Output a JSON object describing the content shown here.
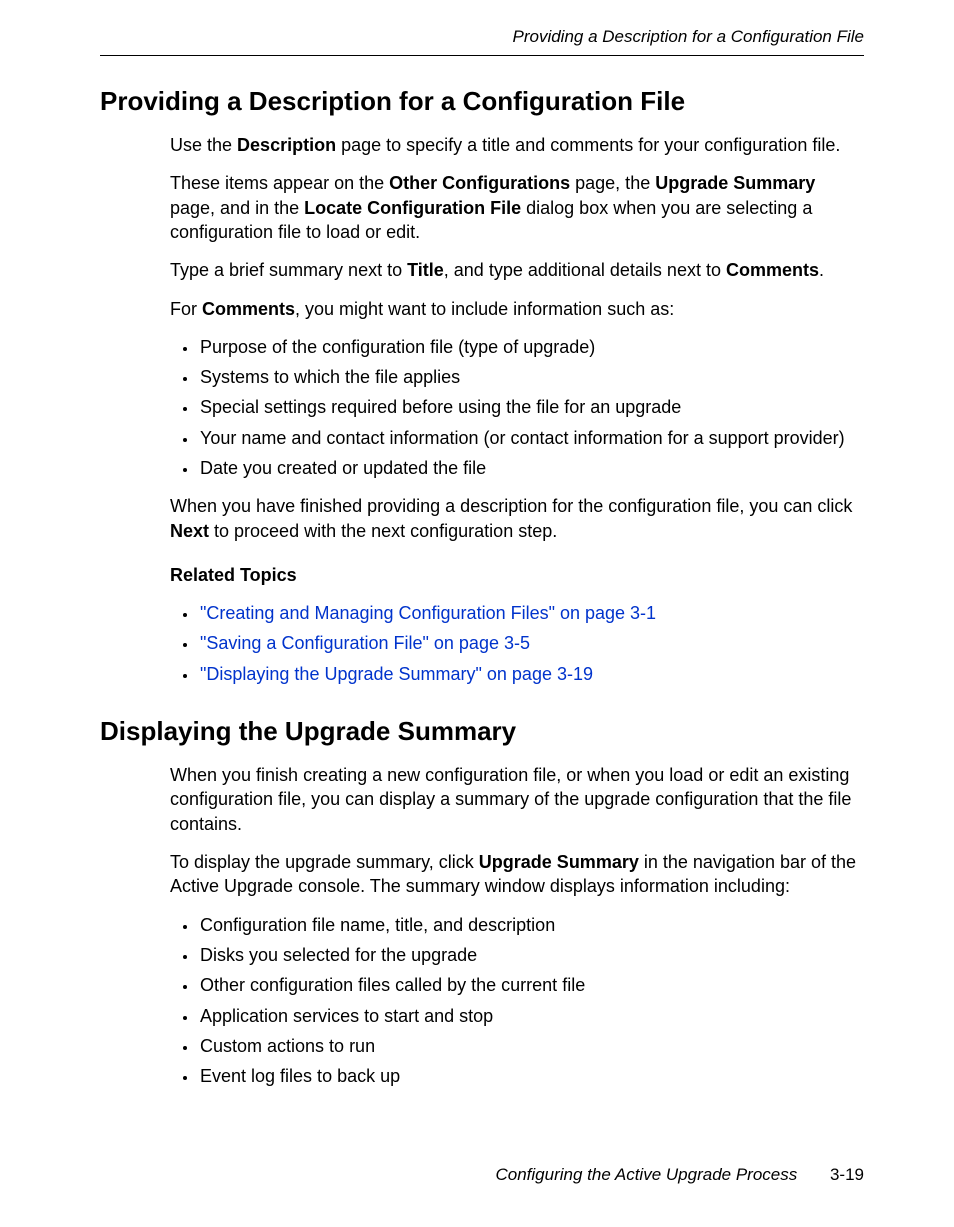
{
  "header": {
    "running_head": "Providing a Description for a Configuration File"
  },
  "section1": {
    "title": "Providing a Description for a Configuration File",
    "para1_pre": "Use the ",
    "para1_b1": "Description",
    "para1_post": " page to specify a title and comments for your configuration file.",
    "para2_a": "These items appear on the ",
    "para2_b1": "Other Configurations",
    "para2_b": " page, the ",
    "para2_b2": "Upgrade Summary",
    "para2_c": " page, and in the ",
    "para2_b3": "Locate Configuration File",
    "para2_d": " dialog box when you are selecting a configuration file to load or edit.",
    "para3_a": "Type a brief summary next to ",
    "para3_b1": "Title",
    "para3_b": ", and type additional details next to ",
    "para3_b2": "Comments",
    "para3_c": ".",
    "para4_a": "For ",
    "para4_b1": "Comments",
    "para4_b": ", you might want to include information such as:",
    "bullets": [
      "Purpose of the configuration file (type of upgrade)",
      "Systems to which the file applies",
      "Special settings required before using the file for an upgrade",
      "Your name and contact information (or contact information for a support provider)",
      "Date you created or updated the file"
    ],
    "para5_a": "When you have finished providing a description for the configuration file, you can click ",
    "para5_b1": "Next",
    "para5_b": " to proceed with the next configuration step.",
    "related_title": "Related Topics",
    "related": [
      "\"Creating and Managing Configuration Files\" on page 3-1",
      "\"Saving a Configuration File\" on page 3-5",
      "\"Displaying the Upgrade Summary\" on page 3-19"
    ]
  },
  "section2": {
    "title": "Displaying the Upgrade Summary",
    "para1": "When you finish creating a new configuration file, or when you load or edit an existing configuration file, you can display a summary of the upgrade configuration that the file contains.",
    "para2_a": "To display the upgrade summary, click ",
    "para2_b1": "Upgrade Summary",
    "para2_b": " in the navigation bar of the Active Upgrade console. The summary window displays information including:",
    "bullets": [
      "Configuration file name, title, and description",
      "Disks you selected for the upgrade",
      "Other configuration files called by the current file",
      "Application services to start and stop",
      "Custom actions to run",
      "Event log files to back up"
    ]
  },
  "footer": {
    "chapter": "Configuring the Active Upgrade Process",
    "page": "3-19"
  }
}
